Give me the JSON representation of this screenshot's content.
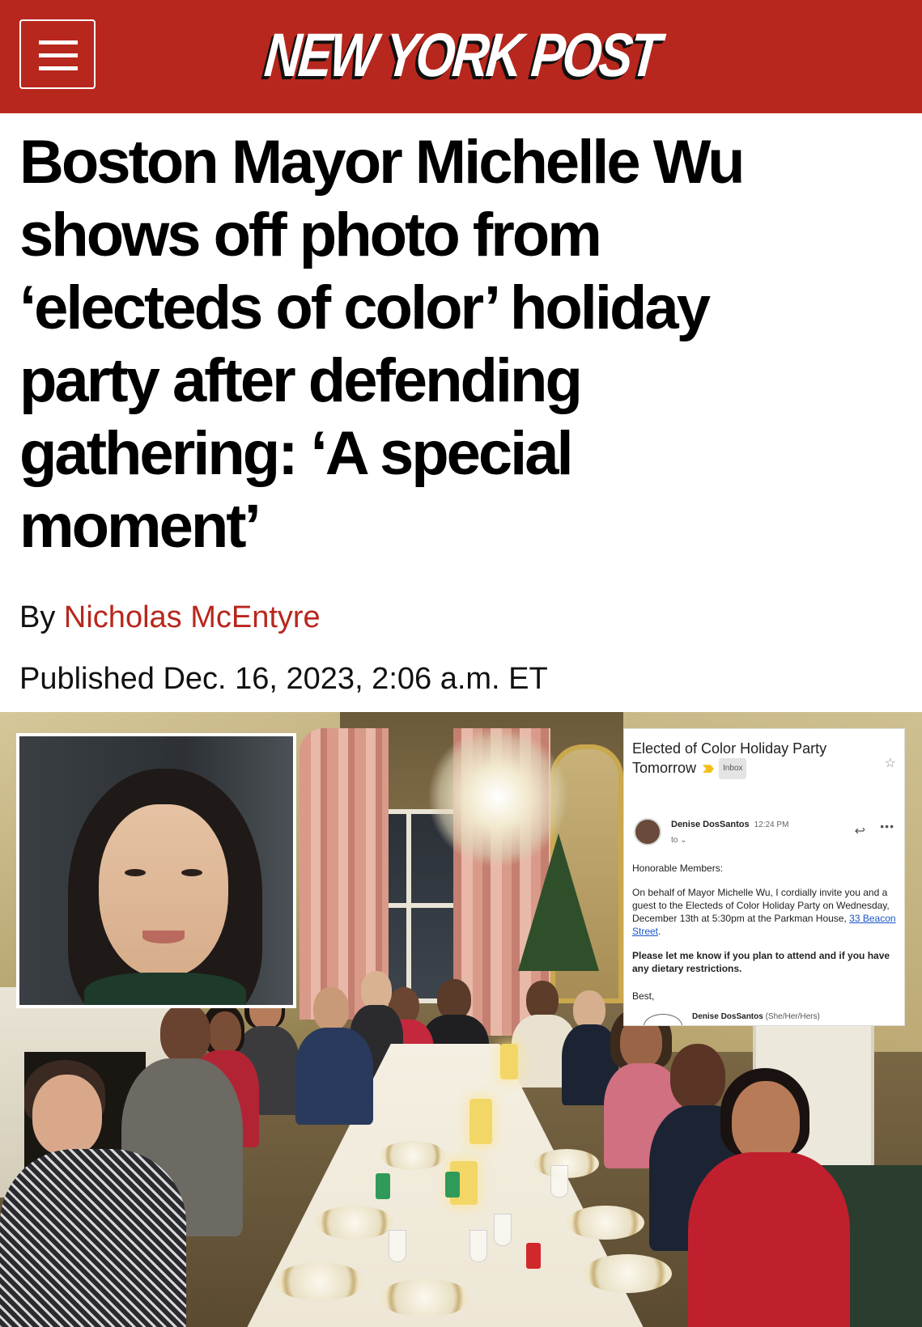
{
  "header": {
    "menu_label": "Menu",
    "logo": "NEW YORK POST",
    "brand_color": "#b8271d"
  },
  "article": {
    "headline_lines": [
      "Boston Mayor Michelle Wu",
      "shows off photo from",
      "‘electeds of color’ holiday",
      "party after defending",
      "gathering: ‘A special",
      "moment’"
    ],
    "byline_prefix": "By",
    "author": "Nicholas McEntyre",
    "published": "Published Dec. 16, 2023, 2:06 a.m. ET"
  },
  "email": {
    "subject_line1": "Elected of Color Holiday Party",
    "subject_line2": "Tomorrow",
    "inbox_tag": "Inbox",
    "sender": "Denise DosSantos",
    "time": "12:24 PM",
    "to": "to",
    "greeting": "Honorable Members:",
    "body_1": "On behalf of Mayor Michelle Wu, I cordially invite you and a guest to the Electeds of Color Holiday Party on Wednesday, December 13th at 5:30pm at the Parkman House, ",
    "link": "33 Beacon Street",
    "body_1_end": ".",
    "body_2": "Please let me know if you plan to attend and if you have any dietary restrictions.",
    "closing": "Best,",
    "sig_name": "Denise DosSantos",
    "sig_pronouns": "(She/Her/Hers)"
  },
  "icons": {
    "menu": "hamburger-icon",
    "star": "star-icon",
    "reply": "reply-icon",
    "more": "more-icon"
  }
}
